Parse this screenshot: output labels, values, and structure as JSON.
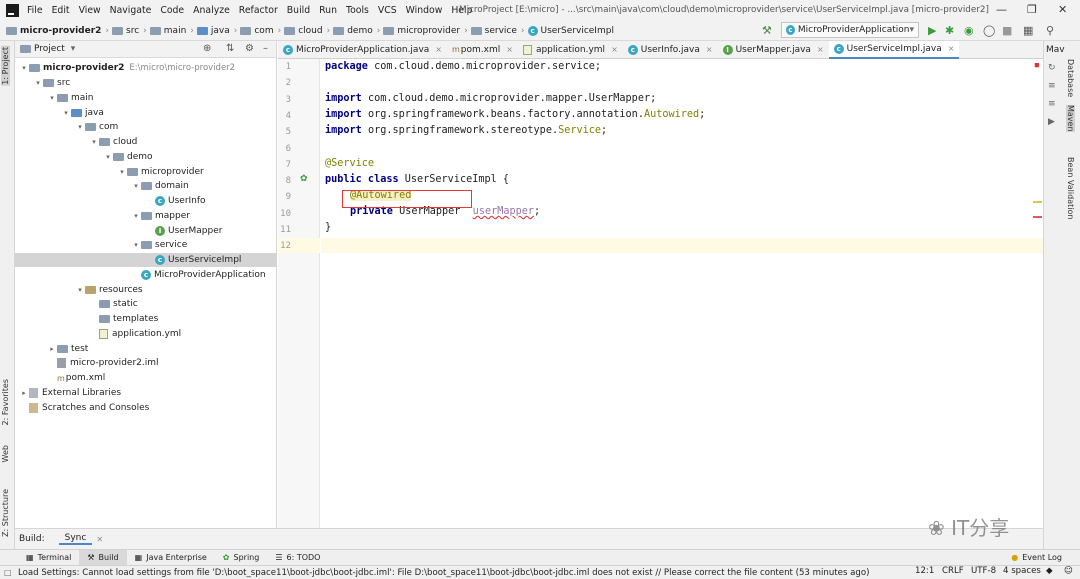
{
  "menu": [
    "File",
    "Edit",
    "View",
    "Navigate",
    "Code",
    "Analyze",
    "Refactor",
    "Build",
    "Run",
    "Tools",
    "VCS",
    "Window",
    "Help"
  ],
  "window_title": "MicroProject [E:\\micro] - ...\\src\\main\\java\\com\\cloud\\demo\\microprovider\\service\\UserServiceImpl.java [micro-provider2]",
  "breadcrumbs": [
    "micro-provider2",
    "src",
    "main",
    "java",
    "com",
    "cloud",
    "demo",
    "microprovider",
    "service",
    "UserServiceImpl"
  ],
  "run_config": "MicroProviderApplication",
  "project_panel": {
    "title": "Project",
    "tree": [
      {
        "label": "micro-provider2",
        "path": "E:\\micro\\micro-provider2",
        "indent": 0,
        "arrow": "down",
        "icon": "folder",
        "bold": true
      },
      {
        "label": "src",
        "indent": 1,
        "arrow": "down",
        "icon": "folder"
      },
      {
        "label": "main",
        "indent": 2,
        "arrow": "down",
        "icon": "folder"
      },
      {
        "label": "java",
        "indent": 3,
        "arrow": "down",
        "icon": "folder-blue"
      },
      {
        "label": "com",
        "indent": 4,
        "arrow": "down",
        "icon": "folder"
      },
      {
        "label": "cloud",
        "indent": 5,
        "arrow": "down",
        "icon": "folder"
      },
      {
        "label": "demo",
        "indent": 6,
        "arrow": "down",
        "icon": "folder"
      },
      {
        "label": "microprovider",
        "indent": 7,
        "arrow": "down",
        "icon": "folder"
      },
      {
        "label": "domain",
        "indent": 8,
        "arrow": "down",
        "icon": "folder"
      },
      {
        "label": "UserInfo",
        "indent": 9,
        "arrow": "",
        "icon": "class"
      },
      {
        "label": "mapper",
        "indent": 8,
        "arrow": "down",
        "icon": "folder"
      },
      {
        "label": "UserMapper",
        "indent": 9,
        "arrow": "",
        "icon": "interface"
      },
      {
        "label": "service",
        "indent": 8,
        "arrow": "down",
        "icon": "folder"
      },
      {
        "label": "UserServiceImpl",
        "indent": 9,
        "arrow": "",
        "icon": "class",
        "selected": true
      },
      {
        "label": "MicroProviderApplication",
        "indent": 8,
        "arrow": "",
        "icon": "class-run"
      },
      {
        "label": "resources",
        "indent": 4,
        "arrow": "down",
        "icon": "folder-res"
      },
      {
        "label": "static",
        "indent": 5,
        "arrow": "",
        "icon": "folder"
      },
      {
        "label": "templates",
        "indent": 5,
        "arrow": "",
        "icon": "folder"
      },
      {
        "label": "application.yml",
        "indent": 5,
        "arrow": "",
        "icon": "yml"
      },
      {
        "label": "test",
        "indent": 2,
        "arrow": "right",
        "icon": "folder"
      },
      {
        "label": "micro-provider2.iml",
        "indent": 2,
        "arrow": "",
        "icon": "iml"
      },
      {
        "label": "pom.xml",
        "indent": 2,
        "arrow": "",
        "icon": "maven"
      },
      {
        "label": "External Libraries",
        "indent": 0,
        "arrow": "right",
        "icon": "libs"
      },
      {
        "label": "Scratches and Consoles",
        "indent": 0,
        "arrow": "",
        "icon": "scratch"
      }
    ]
  },
  "tabs": [
    {
      "label": "MicroProviderApplication.java",
      "icon": "class",
      "active": false
    },
    {
      "label": "pom.xml",
      "icon": "maven",
      "active": false
    },
    {
      "label": "application.yml",
      "icon": "yml",
      "active": false
    },
    {
      "label": "UserInfo.java",
      "icon": "class",
      "active": false
    },
    {
      "label": "UserMapper.java",
      "icon": "interface",
      "active": false
    },
    {
      "label": "UserServiceImpl.java",
      "icon": "class",
      "active": true
    }
  ],
  "code": {
    "line_numbers": [
      "1",
      "2",
      "3",
      "4",
      "5",
      "6",
      "7",
      "8",
      "9",
      "10",
      "11",
      "12"
    ],
    "l1_kw": "package",
    "l1_rest": " com.cloud.demo.microprovider.service;",
    "l3_kw": "import",
    "l3_rest": " com.cloud.demo.microprovider.mapper.UserMapper;",
    "l4_kw": "import",
    "l4_rest": " org.springframework.beans.factory.annotation.",
    "l4_ann": "Autowired",
    "l4_end": ";",
    "l5_kw": "import",
    "l5_rest": " org.springframework.stereotype.",
    "l5_ann": "Service",
    "l5_end": ";",
    "l7_ann": "@Service",
    "l8_kw": "public class",
    "l8_rest": " UserServiceImpl {",
    "l9_ann": "@Autowired",
    "l10_kw": "private",
    "l10_type": " UserMapper  ",
    "l10_field": "userMapper",
    "l10_end": ";",
    "l11": "}"
  },
  "bottom_tool": {
    "title": "Build:",
    "tab": "Sync"
  },
  "bottom_tabs": [
    "Terminal",
    "Build",
    "Java Enterprise",
    "Spring",
    "6: TODO"
  ],
  "event_log": "Event Log",
  "status": {
    "message": "Load Settings: Cannot load settings from file 'D:\\boot_space11\\boot-jdbc\\boot-jdbc.iml': File D:\\boot_space11\\boot-jdbc\\boot-jdbc.iml does not exist // Please correct the file content (53 minutes ago)",
    "position": "12:1",
    "line_sep": "CRLF",
    "encoding": "UTF-8",
    "indent": "4 spaces"
  },
  "side_tabs": {
    "project": "1: Project",
    "favorites": "2: Favorites",
    "web": "Web",
    "structure": "Z: Structure",
    "database": "Database",
    "maven": "Maven",
    "bean": "Bean Validation",
    "mav_label": "Mav"
  },
  "watermark": "IT分享"
}
